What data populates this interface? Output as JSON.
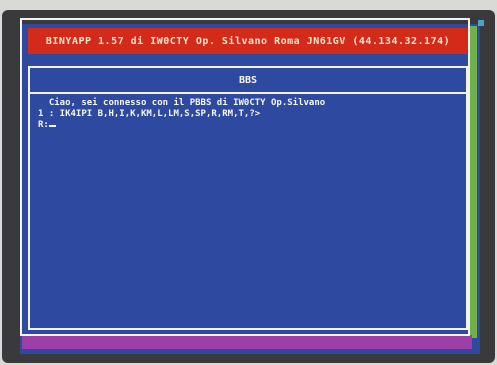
{
  "window": {
    "title": "BINYAPP 1.57 di IW0CTY Op. Silvano Roma JN61GV (44.134.32.174)"
  },
  "panel": {
    "title": "BBS"
  },
  "terminal": {
    "lines": [
      "  Ciao, sei connesso con il PBBS di IW0CTY Op.Silvano",
      "1 : IK4IPI B,H,I,K,KM,L,LM,S,SP,R,RM,T,?>",
      "R:"
    ]
  },
  "colors": {
    "title_bar": "#d42a1a",
    "screen_background": "#2e4aa0",
    "text": "#f7f7f2"
  }
}
